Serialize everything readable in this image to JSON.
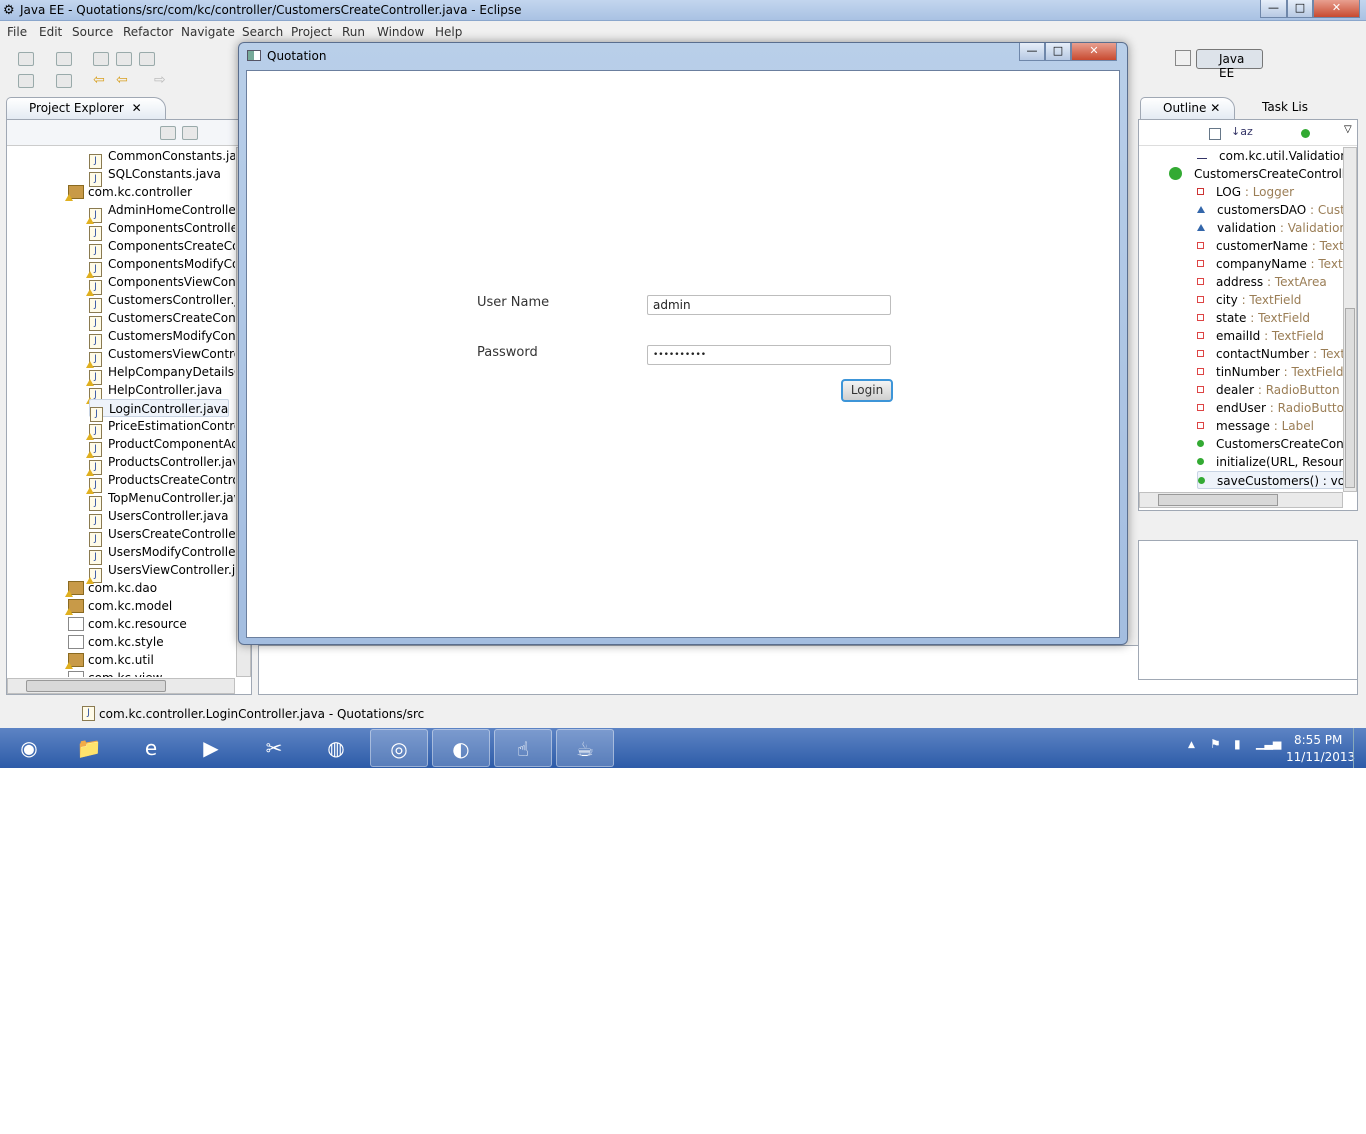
{
  "window": {
    "title": "Java EE - Quotations/src/com/kc/controller/CustomersCreateController.java - Eclipse",
    "minimize": "—",
    "maximize": "□",
    "close": "✕"
  },
  "menu": [
    "File",
    "Edit",
    "Source",
    "Refactor",
    "Navigate",
    "Search",
    "Project",
    "Run",
    "Window",
    "Help"
  ],
  "perspective": {
    "label": "Java EE"
  },
  "project_explorer": {
    "tab": "Project Explorer",
    "items": [
      {
        "label": "CommonConstants.java",
        "type": "file",
        "warn": false
      },
      {
        "label": "SQLConstants.java",
        "type": "file",
        "warn": false
      },
      {
        "label": "com.kc.controller",
        "type": "package",
        "warn": true
      },
      {
        "label": "AdminHomeController.j",
        "type": "file",
        "warn": true
      },
      {
        "label": "ComponentsController.j",
        "type": "file",
        "warn": false
      },
      {
        "label": "ComponentsCreateCont",
        "type": "file",
        "warn": false
      },
      {
        "label": "ComponentsModifyCor",
        "type": "file",
        "warn": true
      },
      {
        "label": "ComponentsViewContro",
        "type": "file",
        "warn": true
      },
      {
        "label": "CustomersController.jav",
        "type": "file",
        "warn": false
      },
      {
        "label": "CustomersCreateContro",
        "type": "file",
        "warn": false
      },
      {
        "label": "CustomersModifyContr",
        "type": "file",
        "warn": false
      },
      {
        "label": "CustomersViewControll",
        "type": "file",
        "warn": true
      },
      {
        "label": "HelpCompanyDetailsCo",
        "type": "file",
        "warn": true
      },
      {
        "label": "HelpController.java",
        "type": "file",
        "warn": true
      },
      {
        "label": "LoginController.java",
        "type": "file",
        "warn": false,
        "selected": true
      },
      {
        "label": "PriceEstimationControll",
        "type": "file",
        "warn": true
      },
      {
        "label": "ProductComponentAdd",
        "type": "file",
        "warn": true
      },
      {
        "label": "ProductsController.java",
        "type": "file",
        "warn": true
      },
      {
        "label": "ProductsCreateControlle",
        "type": "file",
        "warn": true
      },
      {
        "label": "TopMenuController.java",
        "type": "file",
        "warn": false
      },
      {
        "label": "UsersController.java",
        "type": "file",
        "warn": false
      },
      {
        "label": "UsersCreateController.ja",
        "type": "file",
        "warn": false
      },
      {
        "label": "UsersModifyController.j",
        "type": "file",
        "warn": false
      },
      {
        "label": "UsersViewController.java",
        "type": "file",
        "warn": true
      },
      {
        "label": "com.kc.dao",
        "type": "package",
        "warn": true
      },
      {
        "label": "com.kc.model",
        "type": "package",
        "warn": true
      },
      {
        "label": "com.kc.resource",
        "type": "empty-package",
        "warn": false
      },
      {
        "label": "com.kc.style",
        "type": "empty-package",
        "warn": false
      },
      {
        "label": "com.kc.util",
        "type": "package",
        "warn": true
      },
      {
        "label": "com.kc.view",
        "type": "empty-package",
        "warn": false
      }
    ]
  },
  "outline": {
    "tab": "Outline",
    "tab2": "Task Lis",
    "items": [
      {
        "name": "com.kc.util.Validation",
        "type": "",
        "icon": "import",
        "indent": 1
      },
      {
        "name": "CustomersCreateController",
        "type": "",
        "icon": "class",
        "indent": 0
      },
      {
        "name": "LOG",
        "type": "Logger",
        "icon": "private-static-final",
        "indent": 1
      },
      {
        "name": "customersDAO",
        "type": "Custo",
        "icon": "default-field",
        "indent": 1
      },
      {
        "name": "validation",
        "type": "Validation",
        "icon": "default-field",
        "indent": 1
      },
      {
        "name": "customerName",
        "type": "TextFi",
        "icon": "private-field",
        "indent": 1
      },
      {
        "name": "companyName",
        "type": "TextFi",
        "icon": "private-field",
        "indent": 1
      },
      {
        "name": "address",
        "type": "TextArea",
        "icon": "private-field",
        "indent": 1
      },
      {
        "name": "city",
        "type": "TextField",
        "icon": "private-field",
        "indent": 1
      },
      {
        "name": "state",
        "type": "TextField",
        "icon": "private-field",
        "indent": 1
      },
      {
        "name": "emailId",
        "type": "TextField",
        "icon": "private-field",
        "indent": 1
      },
      {
        "name": "contactNumber",
        "type": "TextF",
        "icon": "private-field",
        "indent": 1
      },
      {
        "name": "tinNumber",
        "type": "TextField",
        "icon": "private-field",
        "indent": 1
      },
      {
        "name": "dealer",
        "type": "RadioButton",
        "icon": "private-field",
        "indent": 1
      },
      {
        "name": "endUser",
        "type": "RadioButton",
        "icon": "private-field",
        "indent": 1
      },
      {
        "name": "message",
        "type": "Label",
        "icon": "private-field",
        "indent": 1
      },
      {
        "name": "CustomersCreateContr",
        "type": "",
        "icon": "constructor",
        "indent": 1
      },
      {
        "name": "initialize(URL, Resource",
        "type": "",
        "icon": "public-method",
        "indent": 1
      },
      {
        "name": "saveCustomers() : void",
        "type": "",
        "icon": "public-method",
        "indent": 1,
        "selected": true
      }
    ]
  },
  "dialog": {
    "title": "Quotation",
    "username_label": "User Name",
    "username_value": "admin",
    "password_label": "Password",
    "password_value": "••••••••••",
    "login_button": "Login"
  },
  "status_bar": {
    "text": "com.kc.controller.LoginController.java - Quotations/src"
  },
  "taskbar": {
    "apps": [
      "start",
      "explorer",
      "internet-explorer",
      "media-player",
      "tools",
      "firefox",
      "chrome",
      "eclipse",
      "pointer-app",
      "java"
    ],
    "time": "8:55 PM",
    "date": "11/11/2013"
  },
  "colors": {
    "accent": "#3d95d8",
    "type_text": "#9a7d55"
  }
}
